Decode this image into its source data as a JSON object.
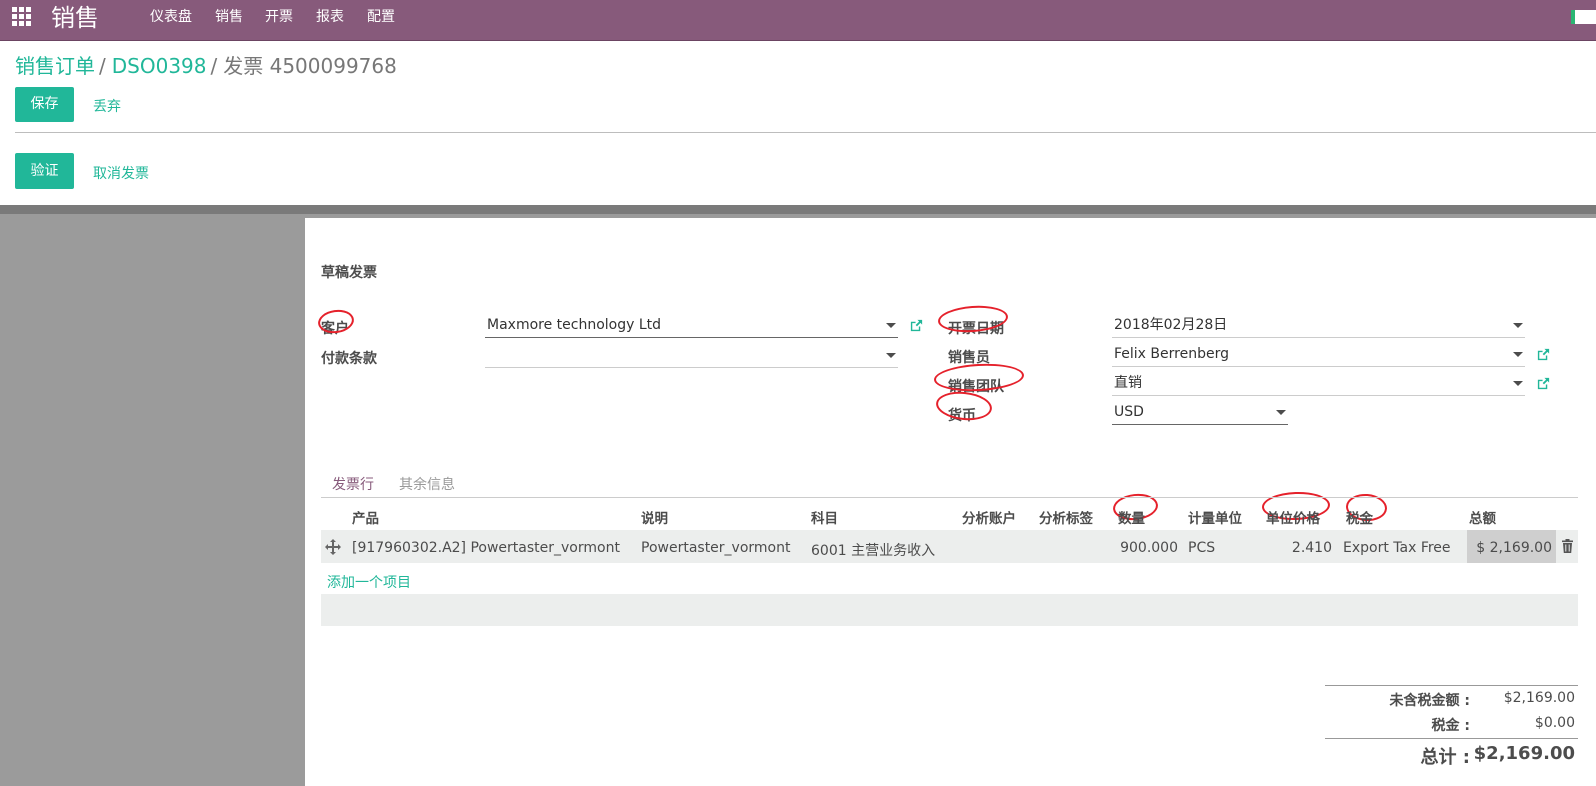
{
  "app": {
    "title": "销售",
    "nav": [
      "仪表盘",
      "销售",
      "开票",
      "报表",
      "配置"
    ]
  },
  "breadcrumb": {
    "items": [
      "销售订单",
      "DSO0398"
    ],
    "current": "发票 4500099768"
  },
  "buttons": {
    "save": "保存",
    "discard": "丢弃",
    "validate": "验证",
    "cancel_invoice": "取消发票"
  },
  "invoice": {
    "status": "草稿发票",
    "customer_label": "客户",
    "customer_value": "Maxmore technology Ltd",
    "payment_terms_label": "付款条款",
    "payment_terms_value": "",
    "invoice_date_label": "开票日期",
    "invoice_date_value": "2018年02月28日",
    "salesperson_label": "销售员",
    "salesperson_value": "Felix Berrenberg",
    "sales_team_label": "销售团队",
    "sales_team_value": "直销",
    "currency_label": "货币",
    "currency_value": "USD"
  },
  "tabs": [
    "发票行",
    "其余信息"
  ],
  "table": {
    "headers": [
      "产品",
      "说明",
      "科目",
      "分析账户",
      "分析标签",
      "数量",
      "计量单位",
      "单位价格",
      "税金",
      "总额"
    ],
    "rows": [
      {
        "product": "[917960302.A2] Powertaster_vormont",
        "description": "Powertaster_vormont",
        "account": "6001 主营业务收入",
        "analytic_account": "",
        "analytic_tags": "",
        "quantity": "900.000",
        "uom": "PCS",
        "unit_price": "2.410",
        "taxes": "Export Tax Free",
        "subtotal": "$ 2,169.00"
      }
    ],
    "add_line": "添加一个项目"
  },
  "totals": {
    "untaxed_label": "未含税金额 :",
    "untaxed_value": "$2,169.00",
    "tax_label": "税金 :",
    "tax_value": "$0.00",
    "total_label": "总计 :",
    "total_value": "$2,169.00"
  },
  "colors": {
    "navbar": "#875a7b",
    "accent": "#21b799",
    "annotation": "#e5212b"
  }
}
